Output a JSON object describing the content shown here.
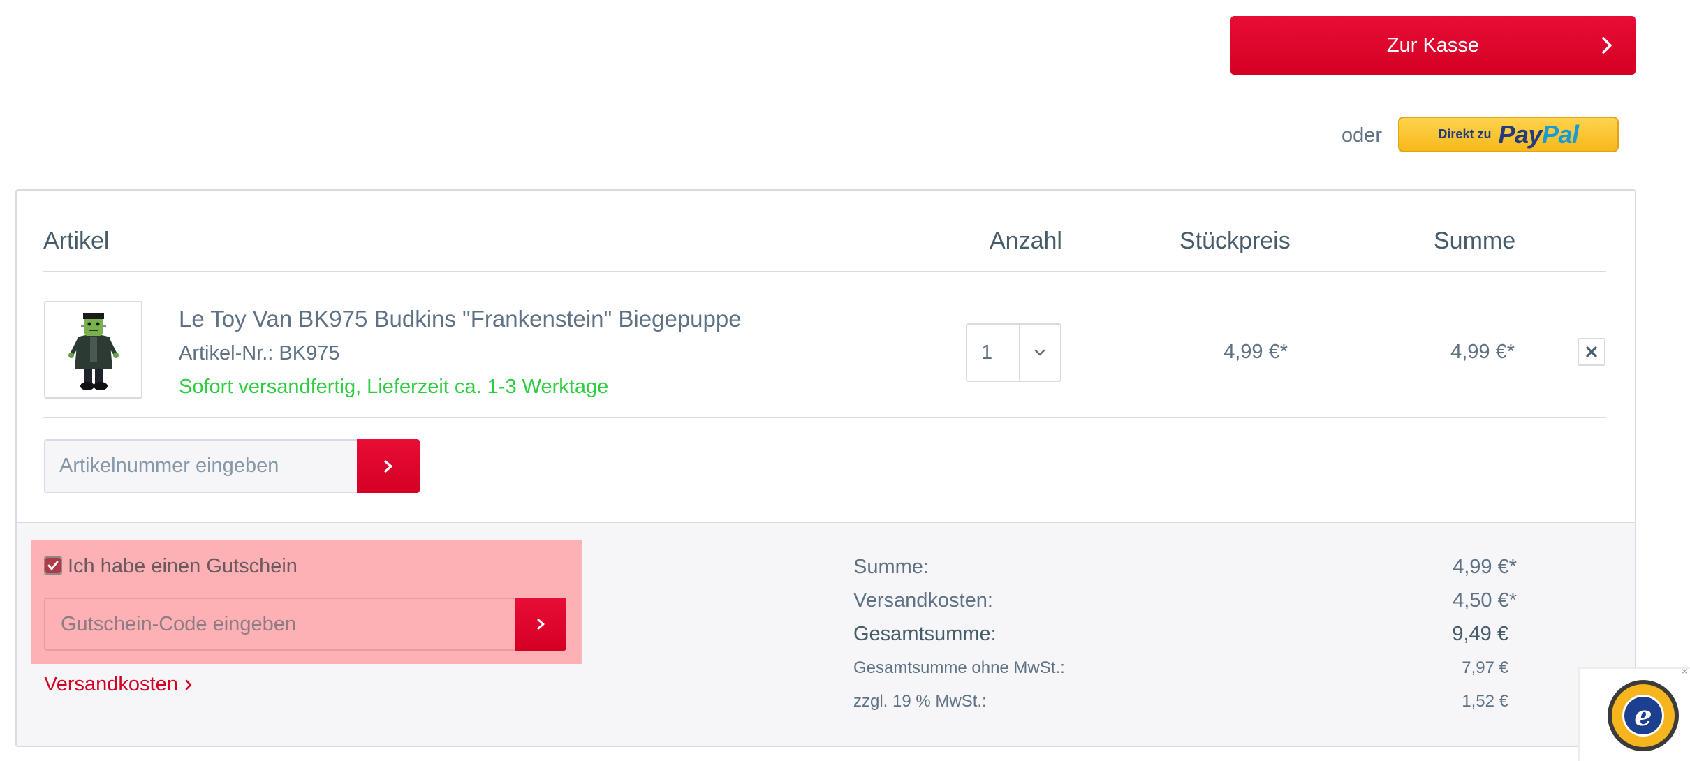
{
  "checkout": {
    "label": "Zur Kasse"
  },
  "paypal": {
    "or_label": "oder",
    "prefix": "Direkt zu",
    "brand_pay": "Pay",
    "brand_pal": "Pal"
  },
  "table": {
    "headers": {
      "article": "Artikel",
      "quantity": "Anzahl",
      "unit_price": "Stückpreis",
      "total": "Summe"
    }
  },
  "item": {
    "name": "Le Toy Van BK975 Budkins \"Frankenstein\" Biegepuppe",
    "sku": "Artikel-Nr.: BK975",
    "availability": "Sofort versandfertig, Lieferzeit ca. 1-3 Werktage",
    "quantity": "1",
    "unit_price": "4,99 €*",
    "total": "4,99 €*"
  },
  "add_by_sku": {
    "placeholder": "Artikelnummer eingeben"
  },
  "voucher": {
    "checkbox_label": "Ich habe einen Gutschein",
    "checked": true,
    "placeholder": "Gutschein-Code eingeben"
  },
  "shipping_link": "Versandkosten",
  "summary": {
    "subtotal_label": "Summe:",
    "subtotal": "4,99 €*",
    "shipping_label": "Versandkosten:",
    "shipping": "4,50 €*",
    "grand_total_label": "Gesamtsumme:",
    "grand_total": "9,49 €",
    "net_total_label": "Gesamtsumme ohne MwSt.:",
    "net_total": "7,97 €",
    "vat_label": "zzgl. 19 % MwSt.:",
    "vat": "1,52 €"
  },
  "trusted_shops": {
    "close": "×"
  },
  "colors": {
    "accent": "#d40024",
    "green": "#2ecc40",
    "paypal_yellow": "#ffc439",
    "text": "#5f7285"
  }
}
